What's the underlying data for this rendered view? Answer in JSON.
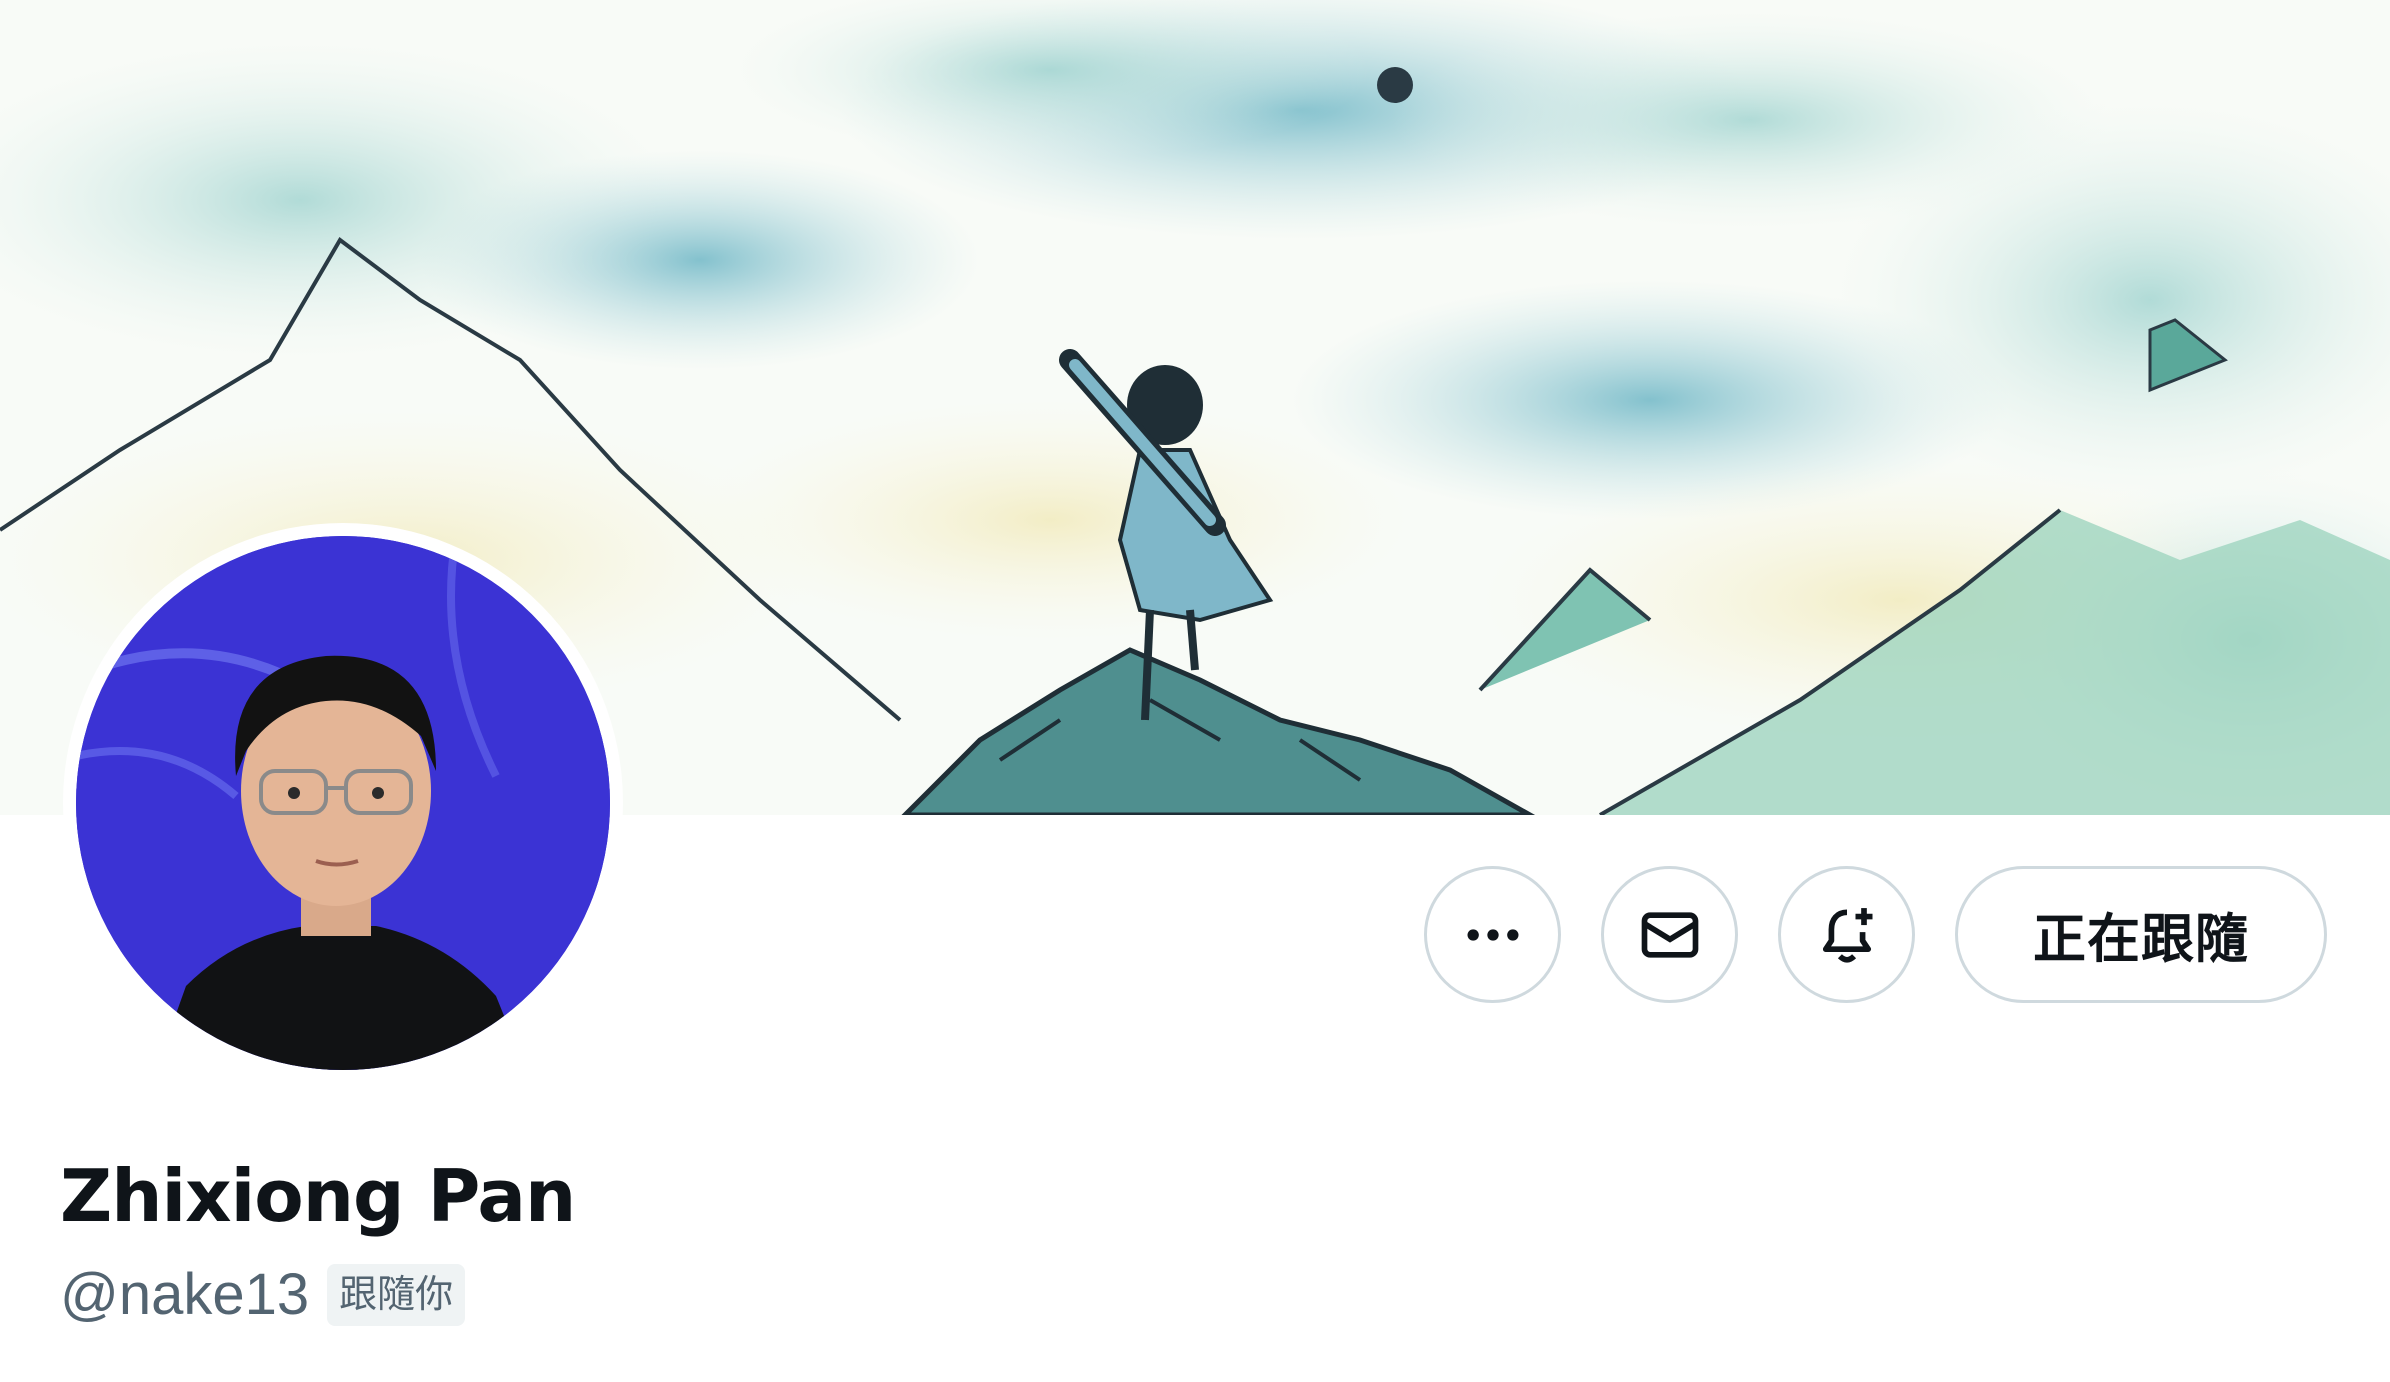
{
  "profile": {
    "display_name": "Zhixiong Pan",
    "handle": "@nake13",
    "follows_you_badge": "跟隨你"
  },
  "actions": {
    "more_icon": "more-horizontal-icon",
    "message_icon": "envelope-icon",
    "notify_icon": "bell-plus-icon",
    "follow_label": "正在跟隨"
  },
  "colors": {
    "text_primary": "#0f1419",
    "text_secondary": "#536471",
    "border": "#cfd9de",
    "badge_bg": "#eff3f4",
    "avatar_bg": "#3b33d4"
  }
}
